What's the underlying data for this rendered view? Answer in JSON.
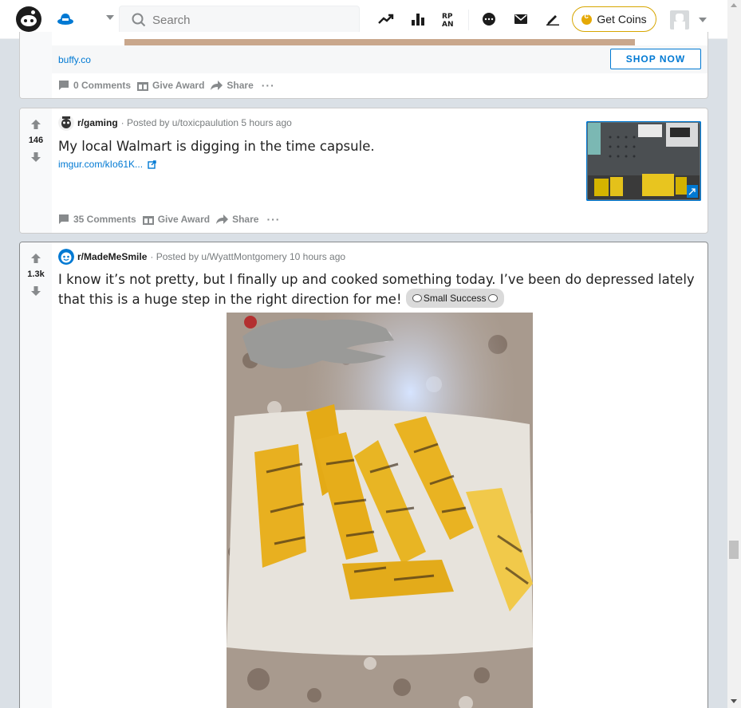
{
  "header": {
    "search_placeholder": "Search",
    "get_coins_label": "Get Coins"
  },
  "ad_post": {
    "domain": "buffy.co",
    "cta_label": "SHOP NOW",
    "comments_label": "0 Comments",
    "award_label": "Give Award",
    "share_label": "Share",
    "more_label": "···"
  },
  "posts": [
    {
      "score": "146",
      "subreddit": "r/gaming",
      "posted_by": "· Posted by u/toxicpaulution 5 hours ago",
      "title": "My local Walmart is digging in the time capsule.",
      "link": "imgur.com/kIo61K...",
      "comments_label": "35 Comments",
      "award_label": "Give Award",
      "share_label": "Share",
      "more_label": "···"
    },
    {
      "score": "1.3k",
      "subreddit": "r/MadeMeSmile",
      "posted_by": "· Posted by u/WyattMontgomery 10 hours ago",
      "title_line1": "I know it’s not pretty, but I finally up and cooked something today. I’ve been do depressed lately",
      "title_line2": "that this is a huge step in the right direction for me!",
      "flair": "Small Success"
    }
  ],
  "colors": {
    "accent": "#0079d3",
    "coins_border": "#d7a600",
    "page_bg": "#dae0e6"
  }
}
